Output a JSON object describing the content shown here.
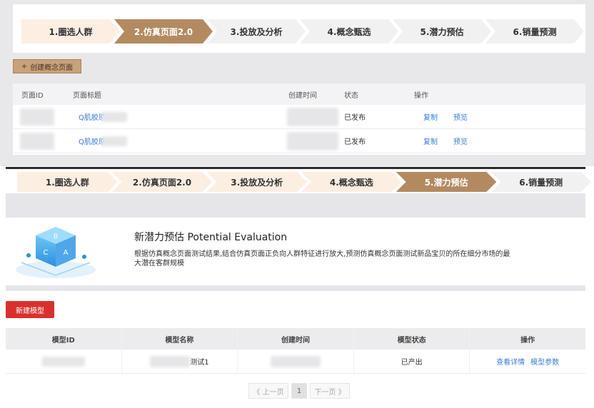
{
  "top": {
    "steps": [
      {
        "label": "1.圈选人群",
        "state": "done"
      },
      {
        "label": "2.仿真页面2.0",
        "state": "active"
      },
      {
        "label": "3.投放及分析",
        "state": "todo"
      },
      {
        "label": "4.概念甄选",
        "state": "todo"
      },
      {
        "label": "5.潜力预估",
        "state": "todo"
      },
      {
        "label": "6.销量预测",
        "state": "todo"
      }
    ],
    "create_button": "创建概念页面",
    "table": {
      "headers": {
        "id": "页面ID",
        "title": "页面标题",
        "created": "创建时间",
        "status": "状态",
        "actions": "操作"
      },
      "rows": [
        {
          "title": "Q肌胶原",
          "status": "已发布",
          "copy": "复制",
          "preview": "预览"
        },
        {
          "title": "Q肌胶原",
          "status": "已发布",
          "copy": "复制",
          "preview": "预览"
        }
      ]
    }
  },
  "bottom": {
    "steps": [
      {
        "label": "1.圈选人群",
        "state": "done"
      },
      {
        "label": "2.仿真页面2.0",
        "state": "done"
      },
      {
        "label": "3.投放及分析",
        "state": "done"
      },
      {
        "label": "4.概念甄选",
        "state": "done"
      },
      {
        "label": "5.潜力预估",
        "state": "active"
      },
      {
        "label": "6.销量预测",
        "state": "todo"
      }
    ],
    "hero": {
      "title": "新潜力预估 Potential Evaluation",
      "description": "根据仿真概念页面测试结果,结合仿真页面正负向人群特征进行放大,预测仿真概念页面测试新品宝贝的所在细分市场的最大潜在客群规模",
      "cube_letters": [
        "B",
        "C",
        "A"
      ]
    },
    "new_model_button": "新建模型",
    "table": {
      "headers": [
        "模型ID",
        "模型名称",
        "创建时间",
        "模型状态",
        "操作"
      ],
      "row": {
        "name_suffix": "测试1",
        "status": "已产出",
        "details": "查看详情",
        "params": "模型参数"
      }
    },
    "pager": {
      "prev": "《 上一页",
      "page": "1",
      "next": "下一页 》"
    }
  },
  "colors": {
    "active_step": "#b38a60",
    "done_step": "#fdeee2",
    "new_button": "#d9302c",
    "link": "#3b7bd8"
  }
}
